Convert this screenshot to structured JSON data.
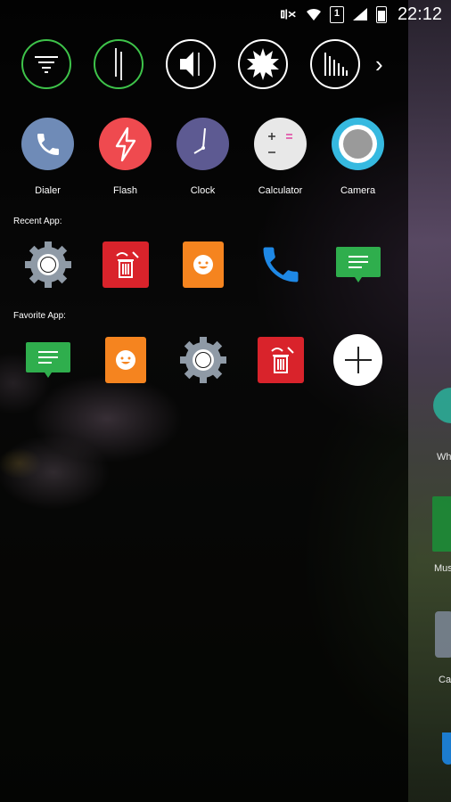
{
  "status_bar": {
    "time": "22:12",
    "sim_slot": "1",
    "icons": [
      "mute-vibrate-icon",
      "wifi-icon",
      "sim-icon",
      "signal-icon",
      "battery-icon"
    ]
  },
  "toggles": [
    {
      "icon": "filter-icon",
      "active": true
    },
    {
      "icon": "flashlight-icon",
      "active": true
    },
    {
      "icon": "volume-icon",
      "active": false
    },
    {
      "icon": "brightness-icon",
      "active": false
    },
    {
      "icon": "equalizer-icon",
      "active": false
    }
  ],
  "quick_apps": [
    {
      "label": "Dialer",
      "color": "#6f8bb7"
    },
    {
      "label": "Flash",
      "color": "#ef4a4f"
    },
    {
      "label": "Clock",
      "color": "#5d5a92"
    },
    {
      "label": "Calculator",
      "color": "#e8e8e8"
    },
    {
      "label": "Camera",
      "color": "#36b9e0"
    }
  ],
  "recent_label": "Recent App:",
  "recent_apps": [
    "settings-icon",
    "uninstaller-icon",
    "contacts-icon",
    "phone-icon",
    "messages-icon"
  ],
  "favorite_label": "Favorite App:",
  "favorite_apps": [
    "messages-icon",
    "contacts-icon",
    "settings-icon",
    "uninstaller-icon",
    "add-icon"
  ],
  "edge_apps": [
    {
      "label": "Wh"
    },
    {
      "label": "Mus"
    },
    {
      "label": "Cal"
    }
  ],
  "colors": {
    "toggle_active": "#3ec34a",
    "settings_gray": "#8f9aa6",
    "uninstaller_red": "#d9232b",
    "contacts_orange": "#f5841f",
    "phone_blue": "#1e88e5",
    "messages_green": "#2fae4d"
  }
}
